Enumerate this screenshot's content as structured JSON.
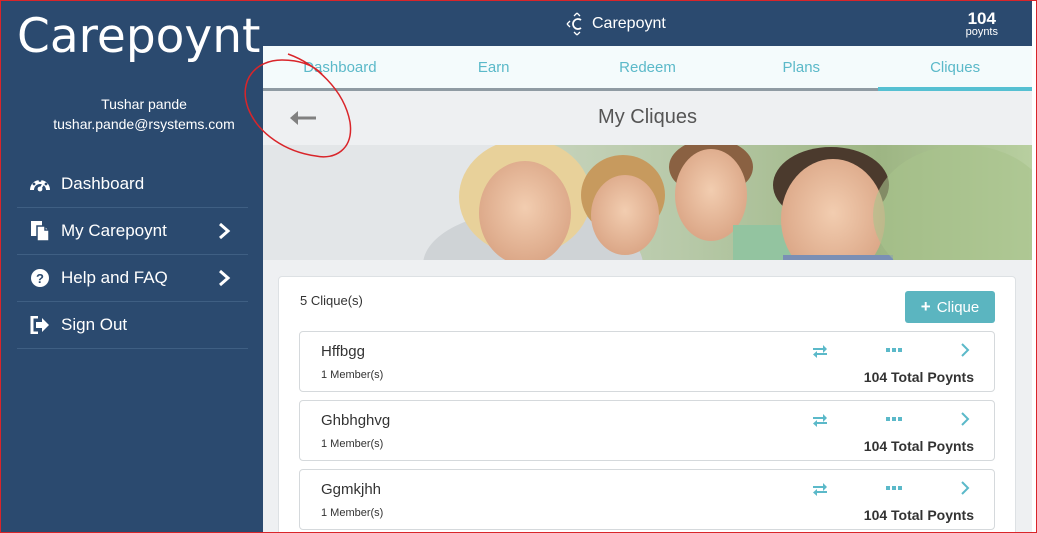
{
  "brand": {
    "logo": "Carepoynt›",
    "topbar_logo": "Carepoynt"
  },
  "user": {
    "name": "Tushar pande",
    "email": "tushar.pande@rsystems.com"
  },
  "sidebar": {
    "items": [
      {
        "label": "Dashboard",
        "icon": "dashboard-icon"
      },
      {
        "label": "My Carepoynt",
        "icon": "document-icon"
      },
      {
        "label": "Help and FAQ",
        "icon": "question-icon"
      },
      {
        "label": "Sign Out",
        "icon": "sign-out-icon"
      }
    ]
  },
  "points": {
    "value": "104",
    "unit": "poynts"
  },
  "tabs": [
    {
      "label": "Dashboard"
    },
    {
      "label": "Earn"
    },
    {
      "label": "Redeem"
    },
    {
      "label": "Plans"
    },
    {
      "label": "Cliques",
      "active": true
    }
  ],
  "page": {
    "title": "My Cliques"
  },
  "cliques": {
    "count_text": "5 Clique(s)",
    "add_label": "Clique",
    "items": [
      {
        "name": "Hffbgg",
        "members": "1 Member(s)",
        "total": "104 Total Poynts"
      },
      {
        "name": "Ghbhghvg",
        "members": "1 Member(s)",
        "total": "104 Total Poynts"
      },
      {
        "name": "Ggmkjhh",
        "members": "1 Member(s)",
        "total": "104 Total Poynts"
      }
    ]
  },
  "colors": {
    "sidebar_bg": "#2b4a6f",
    "accent": "#5bb9c9",
    "button": "#5bb5c0",
    "annotation": "#d9252a"
  }
}
